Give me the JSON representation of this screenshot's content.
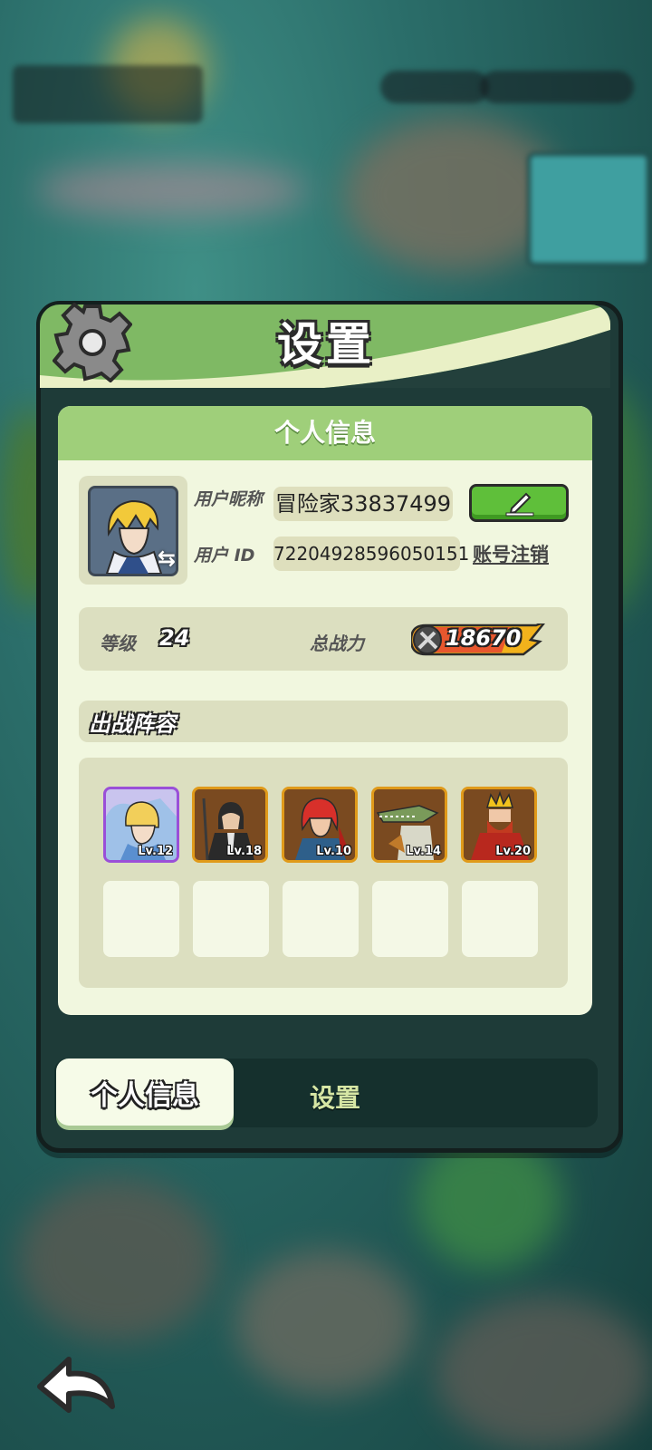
{
  "window": {
    "title": "设置"
  },
  "profile": {
    "section_title": "个人信息",
    "nickname_label": "用户昵称",
    "nickname_value": "冒险家33837499",
    "id_label": "用户 ID",
    "id_value": "72204928596050151",
    "delete_account_label": "账号注销",
    "edit_icon": "pencil-icon",
    "swap_icon": "swap-arrows-icon"
  },
  "stats": {
    "level_label": "等级",
    "level_value": "24",
    "power_label": "总战力",
    "power_value": "18670"
  },
  "lineup": {
    "title": "出战阵容",
    "heroes": [
      {
        "level": "Lv.12",
        "rarity": "purple"
      },
      {
        "level": "Lv.18",
        "rarity": "orange"
      },
      {
        "level": "Lv.10",
        "rarity": "orange"
      },
      {
        "level": "Lv.14",
        "rarity": "orange"
      },
      {
        "level": "Lv.20",
        "rarity": "orange"
      }
    ],
    "empty_slots": 5
  },
  "tabs": [
    {
      "label": "个人信息",
      "active": true
    },
    {
      "label": "设置",
      "active": false
    }
  ],
  "colors": {
    "header_green": "#7fb964",
    "content_bg": "#f1f7df",
    "edit_button": "#5fbf3a",
    "rarity_purple": "#9a4fd8",
    "rarity_orange": "#e09a1a"
  }
}
